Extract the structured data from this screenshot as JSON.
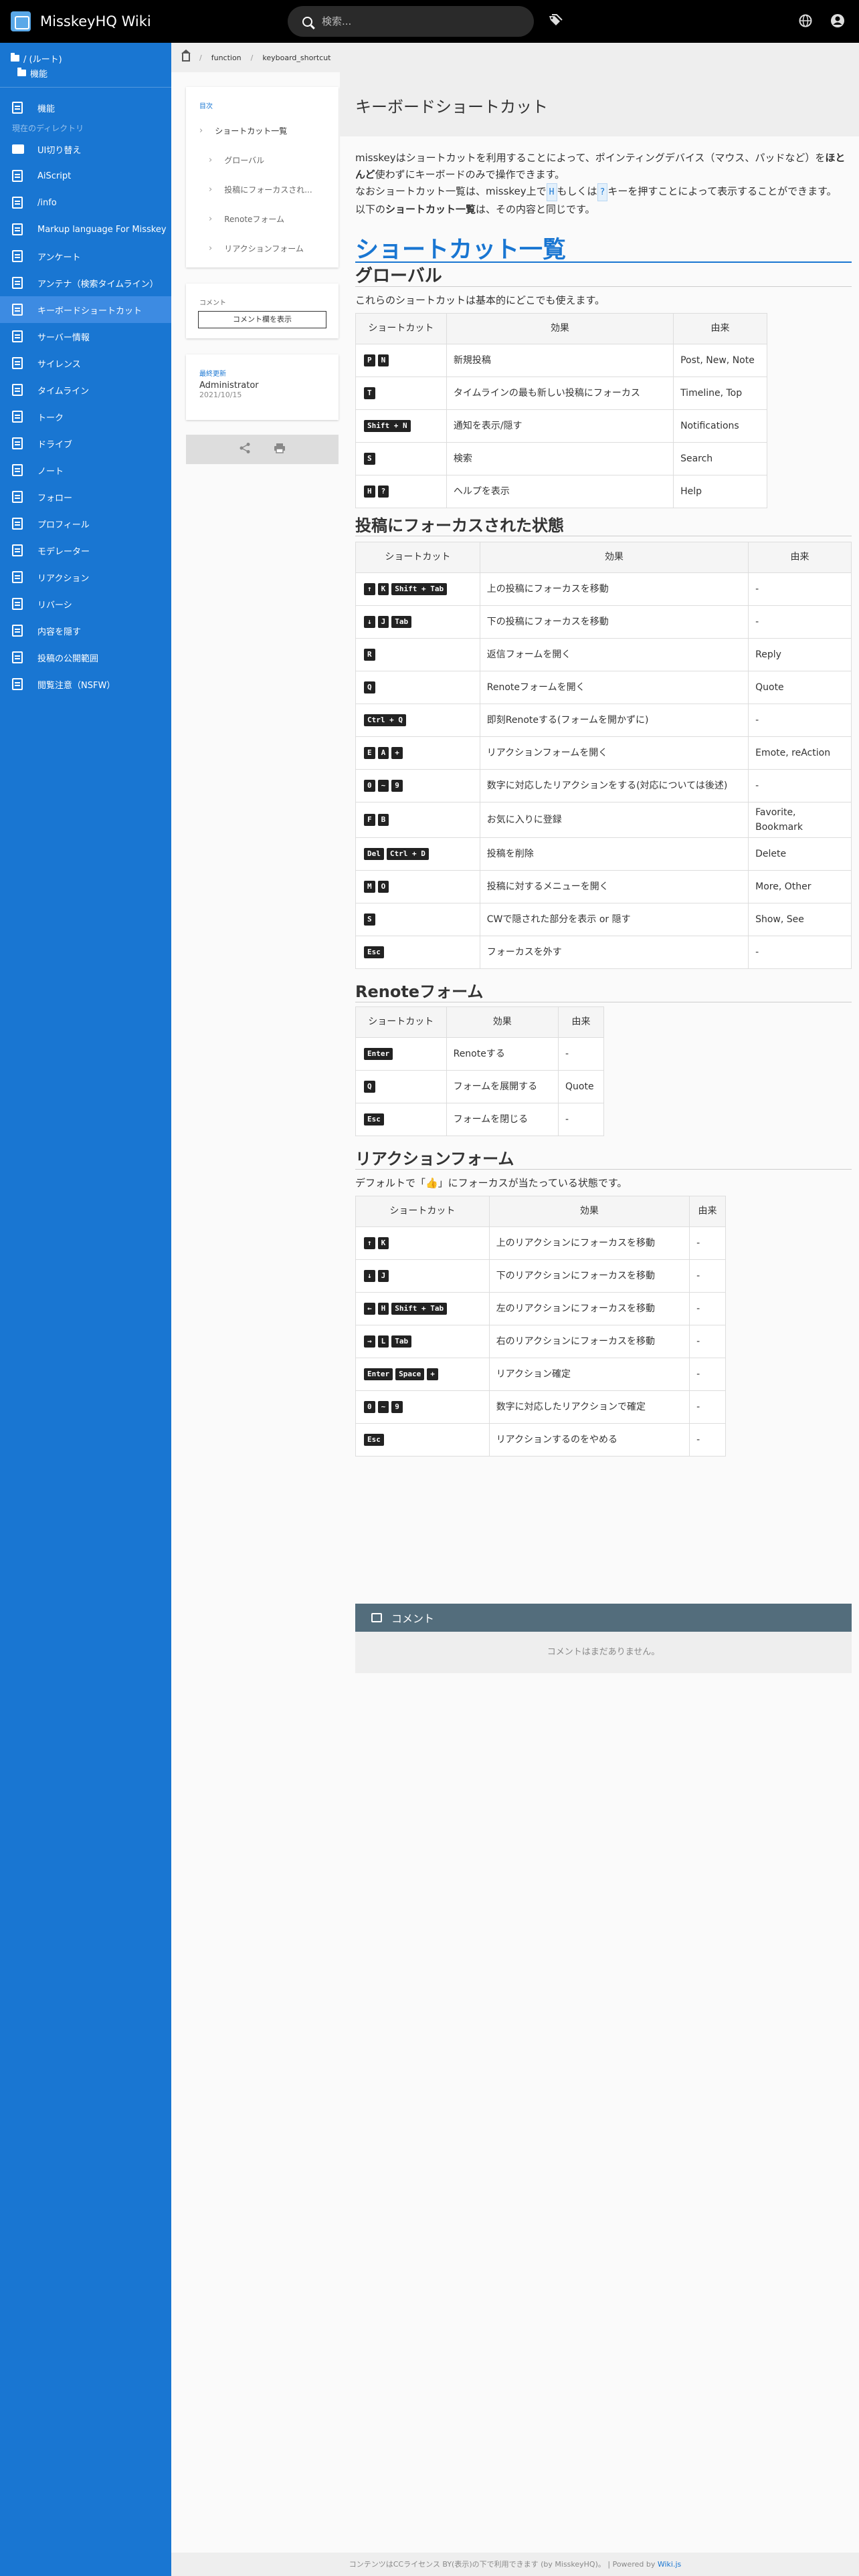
{
  "header": {
    "title": "MisskeyHQ Wiki",
    "search_placeholder": "検索..."
  },
  "sidebar": {
    "root_label": "/ (ルート)",
    "sub_label": "機能",
    "top_item": "機能",
    "section_label": "現在のディレクトリ",
    "items": [
      {
        "label": "UI切り替え",
        "icon": "folder-icon"
      },
      {
        "label": "AiScript",
        "icon": "doc-icon"
      },
      {
        "label": "/info",
        "icon": "doc-icon"
      },
      {
        "label": "Markup language For Misskey",
        "icon": "doc-icon"
      },
      {
        "label": "アンケート",
        "icon": "doc-icon"
      },
      {
        "label": "アンテナ（検索タイムライン）",
        "icon": "doc-icon"
      },
      {
        "label": "キーボードショートカット",
        "icon": "doc-icon",
        "active": true
      },
      {
        "label": "サーバー情報",
        "icon": "doc-icon"
      },
      {
        "label": "サイレンス",
        "icon": "doc-icon"
      },
      {
        "label": "タイムライン",
        "icon": "doc-icon"
      },
      {
        "label": "トーク",
        "icon": "doc-icon"
      },
      {
        "label": "ドライブ",
        "icon": "doc-icon"
      },
      {
        "label": "ノート",
        "icon": "doc-icon"
      },
      {
        "label": "フォロー",
        "icon": "doc-icon"
      },
      {
        "label": "プロフィール",
        "icon": "doc-icon"
      },
      {
        "label": "モデレーター",
        "icon": "doc-icon"
      },
      {
        "label": "リアクション",
        "icon": "doc-icon"
      },
      {
        "label": "リバーシ",
        "icon": "doc-icon"
      },
      {
        "label": "内容を隠す",
        "icon": "doc-icon"
      },
      {
        "label": "投稿の公開範囲",
        "icon": "doc-icon"
      },
      {
        "label": "閲覧注意（NSFW）",
        "icon": "doc-icon"
      }
    ]
  },
  "breadcrumb": [
    "function",
    "keyboard_shortcut"
  ],
  "toc": {
    "label": "目次",
    "items": [
      {
        "label": "ショートカット一覧",
        "level": 1
      },
      {
        "label": "グローバル",
        "level": 2
      },
      {
        "label": "投稿にフォーカスされ...",
        "level": 2
      },
      {
        "label": "Renoteフォーム",
        "level": 2
      },
      {
        "label": "リアクションフォーム",
        "level": 2
      }
    ]
  },
  "comments_card": {
    "label": "コメント",
    "button": "コメント欄を表示"
  },
  "last_edit": {
    "label": "最終更新",
    "author": "Administrator",
    "date": "2021/10/15"
  },
  "page": {
    "title": "キーボードショートカット",
    "intro1a": "misskeyはショートカットを利用することによって、ポインティングデバイス（マウス、パッドなど）を",
    "intro1b": "ほとんど",
    "intro1c": "使わずにキーボードのみで操作できます。",
    "intro2a": "なおショートカット一覧は、misskey上で",
    "intro2k1": "H",
    "intro2b": "もしくは",
    "intro2k2": "?",
    "intro2c": "キーを押すことによって表示することができます。",
    "intro3a": "以下の",
    "intro3b": "ショートカット一覧",
    "intro3c": "は、その内容と同じです。",
    "h_list": "ショートカット一覧",
    "h_global": "グローバル",
    "global_desc": "これらのショートカットは基本的にどこでも使えます。",
    "h_focus": "投稿にフォーカスされた状態",
    "h_renote": "Renoteフォーム",
    "h_reaction": "リアクションフォーム",
    "reaction_desc": "デフォルトで「👍」にフォーカスが当たっている状態です。",
    "col_shortcut": "ショートカット",
    "col_effect": "効果",
    "col_origin": "由来"
  },
  "global_table": [
    {
      "keys": [
        "P",
        "N"
      ],
      "effect": "新規投稿",
      "origin": "Post, New, Note"
    },
    {
      "keys": [
        "T"
      ],
      "effect": "タイムラインの最も新しい投稿にフォーカス",
      "origin": "Timeline, Top"
    },
    {
      "keys": [
        "Shift + N"
      ],
      "effect": "通知を表示/隠す",
      "origin": "Notifications"
    },
    {
      "keys": [
        "S"
      ],
      "effect": "検索",
      "origin": "Search"
    },
    {
      "keys": [
        "H",
        "?"
      ],
      "effect": "ヘルプを表示",
      "origin": "Help"
    }
  ],
  "focus_table": [
    {
      "keys": [
        "↑",
        "K",
        "Shift + Tab"
      ],
      "effect": "上の投稿にフォーカスを移動",
      "origin": "-"
    },
    {
      "keys": [
        "↓",
        "J",
        "Tab"
      ],
      "effect": "下の投稿にフォーカスを移動",
      "origin": "-"
    },
    {
      "keys": [
        "R"
      ],
      "effect": "返信フォームを開く",
      "origin": "Reply"
    },
    {
      "keys": [
        "Q"
      ],
      "effect": "Renoteフォームを開く",
      "origin": "Quote"
    },
    {
      "keys": [
        "Ctrl + Q"
      ],
      "effect": "即刻Renoteする(フォームを開かずに)",
      "origin": "-"
    },
    {
      "keys": [
        "E",
        "A",
        "+"
      ],
      "effect": "リアクションフォームを開く",
      "origin": "Emote, reAction"
    },
    {
      "keys": [
        "0",
        "~",
        "9"
      ],
      "effect": "数字に対応したリアクションをする(対応については後述)",
      "origin": "-"
    },
    {
      "keys": [
        "F",
        "B"
      ],
      "effect": "お気に入りに登録",
      "origin": "Favorite, Bookmark"
    },
    {
      "keys": [
        "Del",
        "Ctrl + D"
      ],
      "effect": "投稿を削除",
      "origin": "Delete"
    },
    {
      "keys": [
        "M",
        "O"
      ],
      "effect": "投稿に対するメニューを開く",
      "origin": "More, Other"
    },
    {
      "keys": [
        "S"
      ],
      "effect": "CWで隠された部分を表示 or 隠す",
      "origin": "Show, See"
    },
    {
      "keys": [
        "Esc"
      ],
      "effect": "フォーカスを外す",
      "origin": "-"
    }
  ],
  "renote_table": [
    {
      "keys": [
        "Enter"
      ],
      "effect": "Renoteする",
      "origin": "-"
    },
    {
      "keys": [
        "Q"
      ],
      "effect": "フォームを展開する",
      "origin": "Quote"
    },
    {
      "keys": [
        "Esc"
      ],
      "effect": "フォームを閉じる",
      "origin": "-"
    }
  ],
  "reaction_table": [
    {
      "keys": [
        "↑",
        "K"
      ],
      "effect": "上のリアクションにフォーカスを移動",
      "origin": "-"
    },
    {
      "keys": [
        "↓",
        "J"
      ],
      "effect": "下のリアクションにフォーカスを移動",
      "origin": "-"
    },
    {
      "keys": [
        "←",
        "H",
        "Shift + Tab"
      ],
      "effect": "左のリアクションにフォーカスを移動",
      "origin": "-"
    },
    {
      "keys": [
        "→",
        "L",
        "Tab"
      ],
      "effect": "右のリアクションにフォーカスを移動",
      "origin": "-"
    },
    {
      "keys": [
        "Enter",
        "Space",
        "+"
      ],
      "effect": "リアクション確定",
      "origin": "-"
    },
    {
      "keys": [
        "0",
        "~",
        "9"
      ],
      "effect": "数字に対応したリアクションで確定",
      "origin": "-"
    },
    {
      "keys": [
        "Esc"
      ],
      "effect": "リアクションするのをやめる",
      "origin": "-"
    }
  ],
  "comments": {
    "title": "コメント",
    "empty": "コメントはまだありません。"
  },
  "footer": {
    "text": "コンテンツはCCライセンス BY(表示)の下で利用できます (by MisskeyHQ)。 | Powered by ",
    "link": "Wiki.js"
  }
}
